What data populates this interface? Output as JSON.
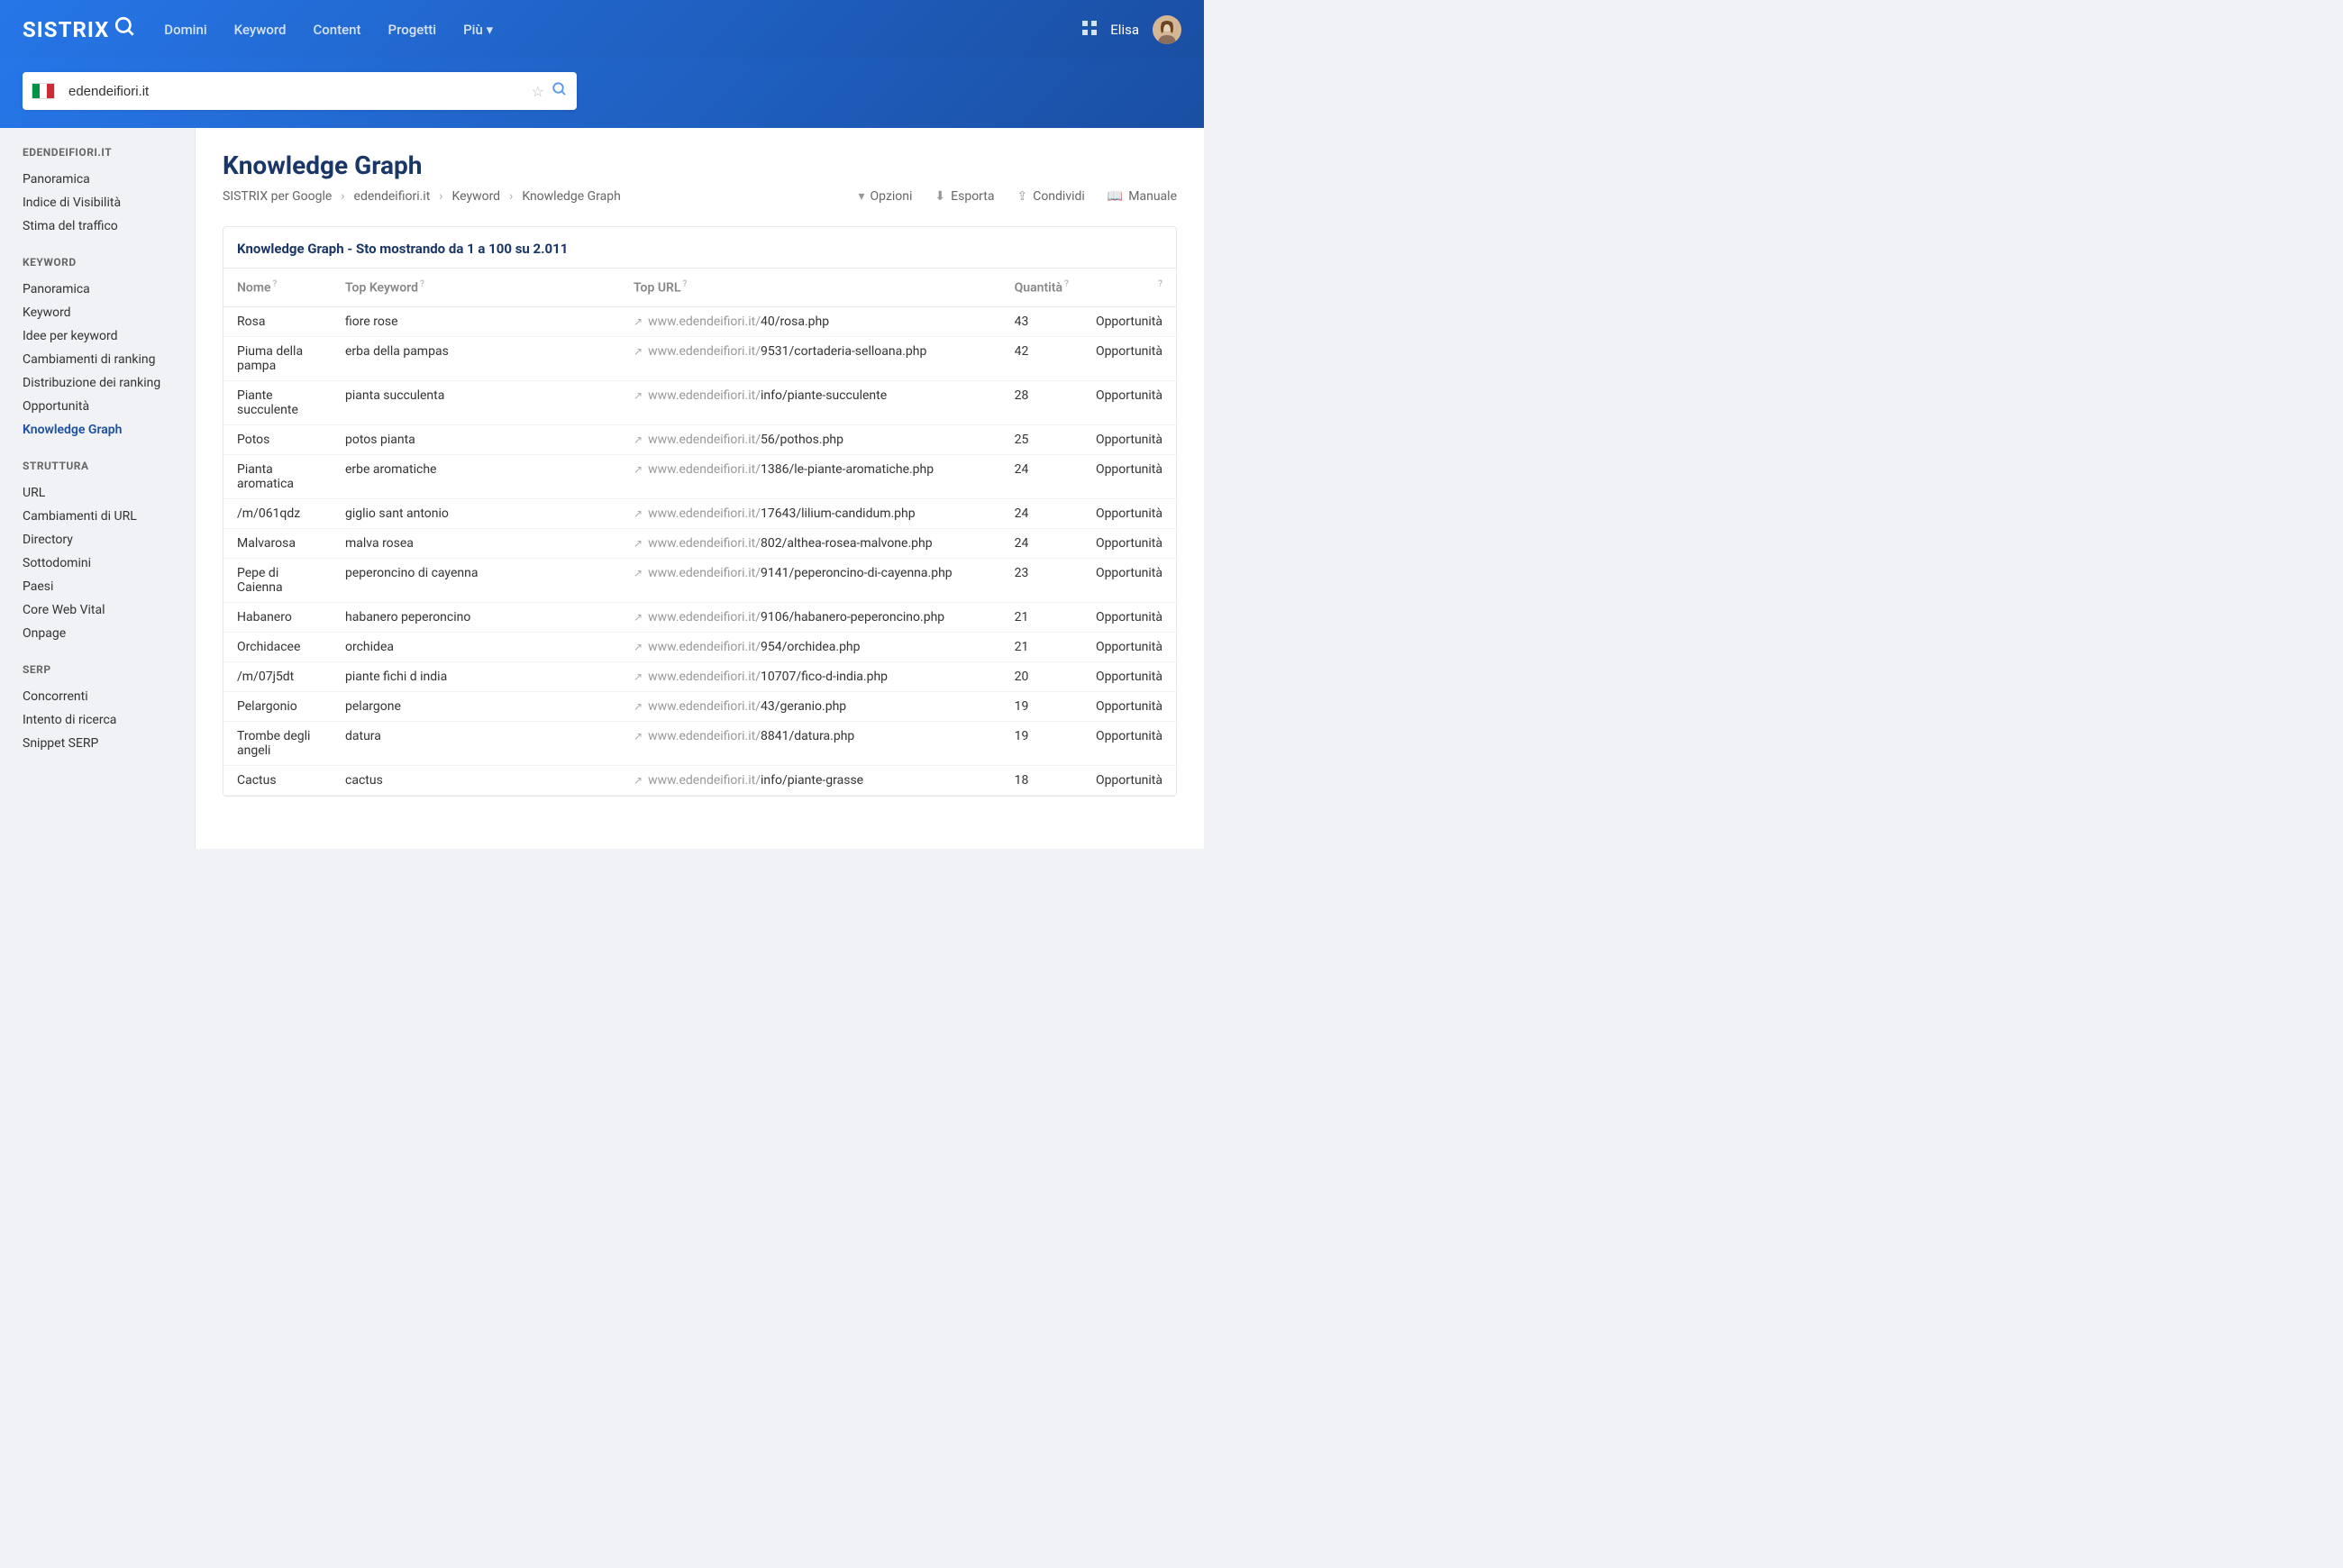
{
  "header": {
    "logo_text": "SISTRIX",
    "nav": [
      "Domini",
      "Keyword",
      "Content",
      "Progetti",
      "Più"
    ],
    "user_name": "Elisa",
    "search_value": "edendeifiori.it"
  },
  "sidebar": {
    "section1_title": "EDENDEIFIORI.IT",
    "section1": [
      "Panoramica",
      "Indice di Visibilità",
      "Stima del traffico"
    ],
    "section2_title": "KEYWORD",
    "section2": [
      "Panoramica",
      "Keyword",
      "Idee per keyword",
      "Cambiamenti di ranking",
      "Distribuzione dei ranking",
      "Opportunità",
      "Knowledge Graph"
    ],
    "section2_active_index": 6,
    "section3_title": "STRUTTURA",
    "section3": [
      "URL",
      "Cambiamenti di URL",
      "Directory",
      "Sottodomini",
      "Paesi",
      "Core Web Vital",
      "Onpage"
    ],
    "section4_title": "SERP",
    "section4": [
      "Concorrenti",
      "Intento di ricerca",
      "Snippet SERP"
    ]
  },
  "page": {
    "title": "Knowledge Graph",
    "breadcrumb": [
      "SISTRIX per Google",
      "edendeifiori.it",
      "Keyword",
      "Knowledge Graph"
    ],
    "actions": {
      "options": "Opzioni",
      "export": "Esporta",
      "share": "Condividi",
      "manual": "Manuale"
    },
    "panel_title": "Knowledge Graph - Sto mostrando da 1 a 100 su 2.011",
    "columns": {
      "name": "Nome",
      "top_keyword": "Top Keyword",
      "top_url": "Top URL",
      "quantity": "Quantità"
    },
    "opp_label": "Opportunità",
    "url_host": "www.edendeifiori.it/",
    "rows": [
      {
        "name": "Rosa",
        "kw": "fiore rose",
        "path": "40/rosa.php",
        "qty": "43"
      },
      {
        "name": "Piuma della pampa",
        "kw": "erba della pampas",
        "path": "9531/cortaderia-selloana.php",
        "qty": "42"
      },
      {
        "name": "Piante succulente",
        "kw": "pianta succulenta",
        "path": "info/piante-succulente",
        "qty": "28"
      },
      {
        "name": "Potos",
        "kw": "potos pianta",
        "path": "56/pothos.php",
        "qty": "25"
      },
      {
        "name": "Pianta aromatica",
        "kw": "erbe aromatiche",
        "path": "1386/le-piante-aromatiche.php",
        "qty": "24"
      },
      {
        "name": "/m/061qdz",
        "kw": "giglio sant antonio",
        "path": "17643/lilium-candidum.php",
        "qty": "24"
      },
      {
        "name": "Malvarosa",
        "kw": "malva rosea",
        "path": "802/althea-rosea-malvone.php",
        "qty": "24"
      },
      {
        "name": "Pepe di Caienna",
        "kw": "peperoncino di cayenna",
        "path": "9141/peperoncino-di-cayenna.php",
        "qty": "23"
      },
      {
        "name": "Habanero",
        "kw": "habanero peperoncino",
        "path": "9106/habanero-peperoncino.php",
        "qty": "21"
      },
      {
        "name": "Orchidacee",
        "kw": "orchidea",
        "path": "954/orchidea.php",
        "qty": "21"
      },
      {
        "name": "/m/07j5dt",
        "kw": "piante fichi d india",
        "path": "10707/fico-d-india.php",
        "qty": "20"
      },
      {
        "name": "Pelargonio",
        "kw": "pelargone",
        "path": "43/geranio.php",
        "qty": "19"
      },
      {
        "name": "Trombe degli angeli",
        "kw": "datura",
        "path": "8841/datura.php",
        "qty": "19"
      },
      {
        "name": "Cactus",
        "kw": "cactus",
        "path": "info/piante-grasse",
        "qty": "18"
      }
    ]
  }
}
